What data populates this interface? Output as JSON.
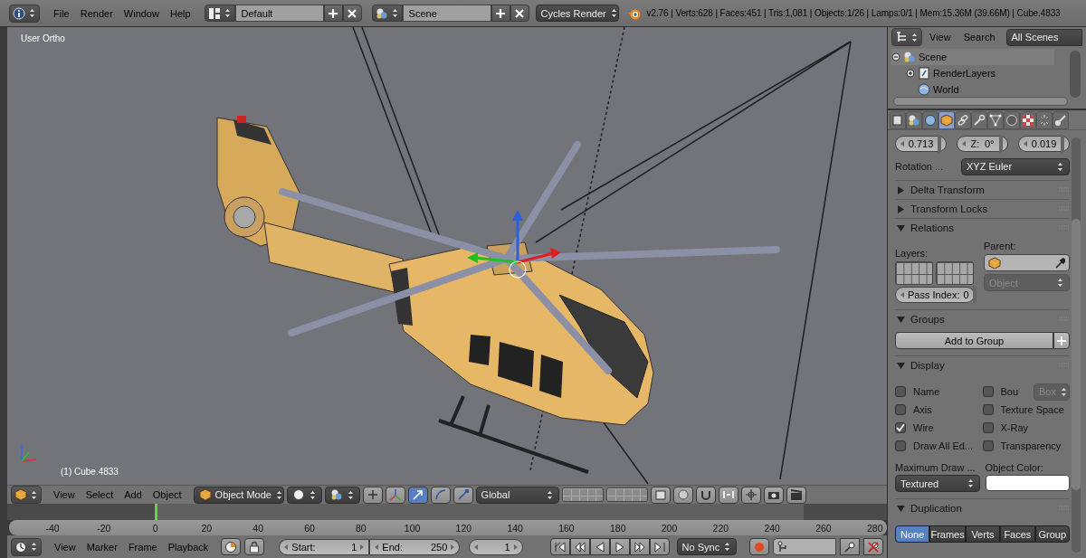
{
  "info_header": {
    "menus": [
      "File",
      "Render",
      "Window",
      "Help"
    ],
    "screen_layout": "Default",
    "scene": "Scene",
    "render_engine": "Cycles Render",
    "stats": "v2.76 | Verts:628 | Faces:451 | Tris:1,081 | Objects:1/26 | Lamps:0/1 | Mem:15.36M (39.66M) | Cube.4833"
  },
  "viewport": {
    "view_name": "User Ortho",
    "object_label": "(1) Cube.4833"
  },
  "viewport_header": {
    "menus": [
      "View",
      "Select",
      "Add",
      "Object"
    ],
    "mode": "Object Mode",
    "transform_orientation": "Global"
  },
  "outliner": {
    "menus": [
      "View",
      "Search"
    ],
    "display_mode": "All Scenes",
    "tree": [
      {
        "label": "Scene",
        "expanded": true,
        "children": [
          {
            "label": "RenderLayers",
            "expanded": false
          },
          {
            "label": "World"
          }
        ]
      }
    ]
  },
  "properties": {
    "tabs": [
      {
        "kind": "render-layers",
        "selected": false
      },
      {
        "kind": "scene",
        "selected": false
      },
      {
        "kind": "world",
        "selected": false
      },
      {
        "kind": "object",
        "selected": true
      },
      {
        "kind": "constraints",
        "selected": false
      },
      {
        "kind": "modifiers",
        "selected": false
      },
      {
        "kind": "data",
        "selected": false
      },
      {
        "kind": "material",
        "selected": false
      },
      {
        "kind": "texture",
        "selected": false
      },
      {
        "kind": "particles",
        "selected": false
      },
      {
        "kind": "physics",
        "selected": false
      }
    ],
    "transform_fields": [
      {
        "value": "0.713"
      },
      {
        "label": "Z:",
        "value": "0°"
      },
      {
        "value": "0.019"
      }
    ],
    "rotation_mode": {
      "label": "Rotation ...",
      "value": "XYZ Euler"
    },
    "panels": [
      {
        "title": "Delta Transform",
        "expanded": false
      },
      {
        "title": "Transform Locks",
        "expanded": false
      },
      {
        "kind": "relations",
        "title": "Relations",
        "expanded": true,
        "layers_label": "Layers:",
        "parent_label": "Parent:",
        "parent_type": {
          "value": "Object",
          "disabled": true
        },
        "pass_index": {
          "label": "Pass Index:",
          "value": "0"
        }
      },
      {
        "kind": "groups",
        "title": "Groups",
        "expanded": true,
        "button": "Add to Group"
      },
      {
        "kind": "display",
        "title": "Display",
        "expanded": true,
        "checkboxes": [
          {
            "label": "Name",
            "checked": false
          },
          {
            "label": "Bou",
            "checked": false,
            "dropdown": {
              "value": "Box",
              "disabled": true
            }
          },
          {
            "label": "Axis",
            "checked": false
          },
          {
            "label": "Texture Space",
            "checked": false
          },
          {
            "label": "Wire",
            "checked": true
          },
          {
            "label": "X-Ray",
            "checked": false
          },
          {
            "label": "Draw All Ed...",
            "checked": false
          },
          {
            "label": "Transparency",
            "checked": false
          }
        ],
        "max_draw_label": "Maximum Draw ...",
        "max_draw_type": "Textured",
        "object_color_label": "Object Color:"
      },
      {
        "kind": "duplication",
        "title": "Duplication",
        "expanded": true,
        "options": [
          {
            "label": "None",
            "selected": true
          },
          {
            "label": "Frames",
            "selected": false
          },
          {
            "label": "Verts",
            "selected": false
          },
          {
            "label": "Faces",
            "selected": false
          },
          {
            "label": "Group",
            "selected": false
          }
        ]
      }
    ]
  },
  "timeline": {
    "playhead": {
      "level": 0.169
    },
    "ruler_ticks": [
      "-40",
      "-20",
      "0",
      "20",
      "40",
      "60",
      "80",
      "100",
      "120",
      "140",
      "160",
      "180",
      "200",
      "220",
      "240",
      "260",
      "280"
    ],
    "menus": [
      "View",
      "Marker",
      "Frame",
      "Playback"
    ],
    "start": {
      "label": "Start:",
      "value": "1"
    },
    "end": {
      "label": "End:",
      "value": "250"
    },
    "current_frame": "1",
    "sync_mode": "No Sync"
  }
}
